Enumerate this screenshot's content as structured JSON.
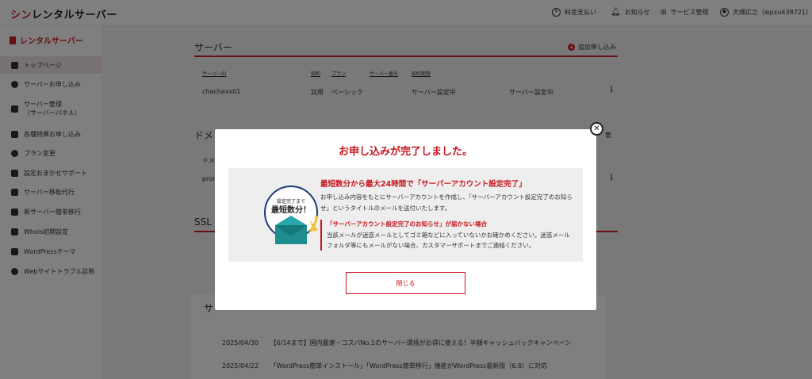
{
  "header": {
    "logo_accent": "シン",
    "logo_rest": "レンタルサーバー",
    "nav": [
      {
        "label": "料金支払い",
        "icon": "yen-icon"
      },
      {
        "label": "お知らせ",
        "icon": "bell-icon"
      },
      {
        "label": "サービス管理",
        "icon": "grid-icon"
      },
      {
        "label": "大畑広之（wpxu438721）",
        "icon": "user-icon"
      }
    ]
  },
  "sidebar": {
    "title": "レンタルサーバー",
    "items": [
      {
        "label": "トップページ",
        "icon": "home-icon"
      },
      {
        "label": "サーバーお申し込み",
        "icon": "plus-circle-icon"
      },
      {
        "label": "サーバー管理",
        "label2": "（サーバーパネル）",
        "icon": "server-icon"
      },
      {
        "label": "各種特典お申し込み",
        "icon": "gift-icon"
      },
      {
        "label": "プラン変更",
        "icon": "refresh-icon"
      },
      {
        "label": "設定おまかせサポート",
        "icon": "wrench-icon"
      },
      {
        "label": "サーバー移転代行",
        "icon": "server-move-icon"
      },
      {
        "label": "新サーバー簡単移行",
        "icon": "truck-icon"
      },
      {
        "label": "Whois初期設定",
        "icon": "document-icon"
      },
      {
        "label": "WordPressテーマ",
        "icon": "browser-icon"
      },
      {
        "label": "Webサイトトラブル診断",
        "icon": "stethoscope-icon"
      }
    ]
  },
  "servers": {
    "title": "サーバー",
    "add_label": "追加申し込み",
    "columns": [
      "サーバーID",
      "契約",
      "プラン",
      "サーバー番号",
      "契約期限"
    ],
    "row": {
      "id": "chachaxx01",
      "contract": "試用",
      "plan": "ベーシック",
      "number": "サーバー設定中",
      "expiry": "サーバー設定中"
    }
  },
  "domains": {
    "title_partial": "ドメ",
    "right_partial": "管",
    "col_partial": "ドメ",
    "cell_partial": "prom"
  },
  "ssl": {
    "title_partial": "SSL"
  },
  "news": {
    "title_partial": "サ",
    "items": [
      {
        "date": "2025/04/30",
        "text": "【6/14まで】国内最速・コスパNo.1のサーバー環境がお得に使える！半額キャッシュバックキャンペーン"
      },
      {
        "date": "2025/04/22",
        "text": "「WordPress簡単インストール」「WordPress簡単移行」機能がWordPress最新版（6.8）に対応"
      }
    ]
  },
  "modal": {
    "title": "お申し込みが完了しました。",
    "badge_small": "設定完了まで",
    "badge_big": "最短数分！",
    "info_head": "最短数分から最大24時間で「サーバーアカウント設定完了」",
    "info_body": "お申し込み内容をもとにサーバーアカウントを作成し、「サーバーアカウント設定完了のお知らせ」というタイトルのメールを送付いたします。",
    "warn_head": "「サーバーアカウント設定完了のお知らせ」が届かない場合",
    "warn_body": "当該メールが迷惑メールとしてゴミ箱などに入っていないかお確かめください。迷惑メールフォルダ等にもメールがない場合、カスタマーサポートまでご連絡ください。",
    "close_label": "閉じる",
    "close_icon": "close-icon"
  },
  "colors": {
    "brand_red": "#d11f2b",
    "overlay": "rgba(0,0,0,0.5)"
  }
}
